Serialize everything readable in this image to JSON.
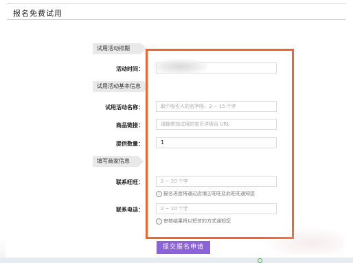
{
  "page": {
    "title": "报名免费试用"
  },
  "sections": {
    "schedule": "试用活动排期",
    "basic": "试用活动基本信息",
    "merchant": "填写商家信息"
  },
  "fields": {
    "activity_time": {
      "label": "活动时间："
    },
    "activity_name": {
      "label": "试用活动名称：",
      "placeholder": "取个吸引人的名字呗，3 ~ 15 个字"
    },
    "product_link": {
      "label": "商品链接：",
      "placeholder": "请输参加试用的宝贝详情页 URL"
    },
    "quantity": {
      "label": "提供数量：",
      "value": "1"
    },
    "wangwang": {
      "label": "联系旺旺：",
      "placeholder": "2 ~ 20 个字",
      "hint": "报名进度将通过店铺主旺旺及此旺旺通知您"
    },
    "phone": {
      "label": "联系电话：",
      "placeholder": "2 ~ 20 个字",
      "hint": "审核结果将以短信的方式通知您"
    }
  },
  "buttons": {
    "submit": "提交报名申请"
  },
  "colors": {
    "highlight": "#f0642d",
    "submit_bg": "#8c62d8"
  }
}
